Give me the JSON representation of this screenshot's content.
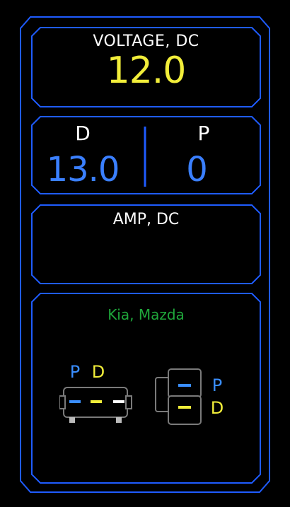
{
  "voltage": {
    "title": "VOLTAGE, DC",
    "value": "12.0"
  },
  "readings": {
    "d": {
      "label": "D",
      "value": "13.0"
    },
    "p": {
      "label": "P",
      "value": "0"
    }
  },
  "amp": {
    "title": "AMP, DC"
  },
  "connector": {
    "brand": "Kia, Mazda",
    "left_pins": {
      "p_label": "P",
      "d_label": "D"
    },
    "right_pins": {
      "p_label": "P",
      "d_label": "D"
    }
  },
  "colors": {
    "frame_blue": "#2060ff",
    "value_yellow": "#f2ee3a",
    "value_blue": "#3a7fff",
    "brand_green": "#1fa83b"
  }
}
